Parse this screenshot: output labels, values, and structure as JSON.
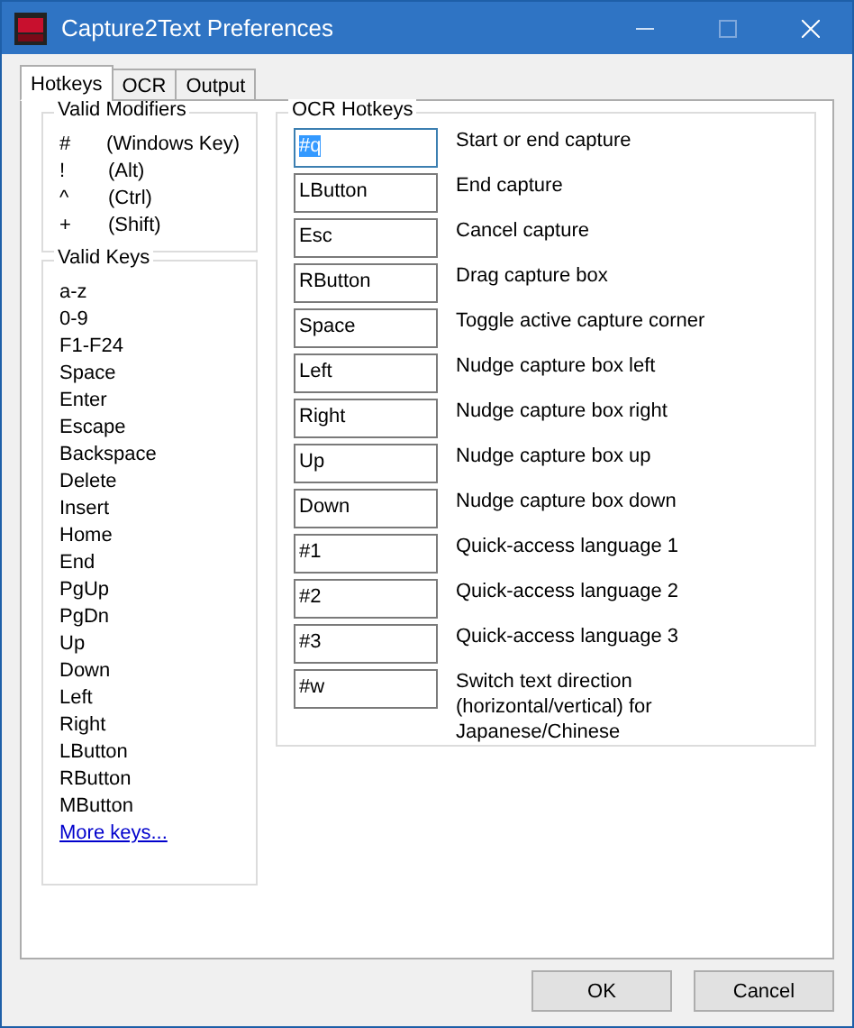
{
  "window": {
    "title": "Capture2Text Preferences"
  },
  "tabs": [
    {
      "label": "Hotkeys",
      "selected": true
    },
    {
      "label": "OCR",
      "selected": false
    },
    {
      "label": "Output",
      "selected": false
    }
  ],
  "valid_modifiers": {
    "title": "Valid Modifiers",
    "items": [
      {
        "symbol": "#",
        "meaning": "(Windows Key)"
      },
      {
        "symbol": "!",
        "meaning": "(Alt)"
      },
      {
        "symbol": "^",
        "meaning": "(Ctrl)"
      },
      {
        "symbol": "+",
        "meaning": "(Shift)"
      }
    ]
  },
  "valid_keys": {
    "title": "Valid Keys",
    "items": [
      "a-z",
      "0-9",
      "F1-F24",
      "Space",
      "Enter",
      "Escape",
      "Backspace",
      "Delete",
      "Insert",
      "Home",
      "End",
      "PgUp",
      "PgDn",
      "Up",
      "Down",
      "Left",
      "Right",
      "LButton",
      "RButton",
      "MButton"
    ],
    "link": "More keys..."
  },
  "ocr_hotkeys": {
    "title": "OCR Hotkeys",
    "rows": [
      {
        "value": "#q",
        "label": "Start or end capture",
        "selected": true
      },
      {
        "value": "LButton",
        "label": "End capture",
        "selected": false
      },
      {
        "value": "Esc",
        "label": "Cancel capture",
        "selected": false
      },
      {
        "value": "RButton",
        "label": "Drag capture box",
        "selected": false
      },
      {
        "value": "Space",
        "label": "Toggle active capture corner",
        "selected": false
      },
      {
        "value": "Left",
        "label": "Nudge capture box left",
        "selected": false
      },
      {
        "value": "Right",
        "label": "Nudge capture box right",
        "selected": false
      },
      {
        "value": "Up",
        "label": "Nudge capture box up",
        "selected": false
      },
      {
        "value": "Down",
        "label": "Nudge capture box down",
        "selected": false
      },
      {
        "value": "#1",
        "label": "Quick-access language 1",
        "selected": false
      },
      {
        "value": "#2",
        "label": "Quick-access language 2",
        "selected": false
      },
      {
        "value": "#3",
        "label": "Quick-access language 3",
        "selected": false
      },
      {
        "value": "#w",
        "label": "Switch text direction (horizontal/vertical) for Japanese/Chinese",
        "selected": false
      }
    ]
  },
  "buttons": [
    "OK",
    "Cancel"
  ]
}
